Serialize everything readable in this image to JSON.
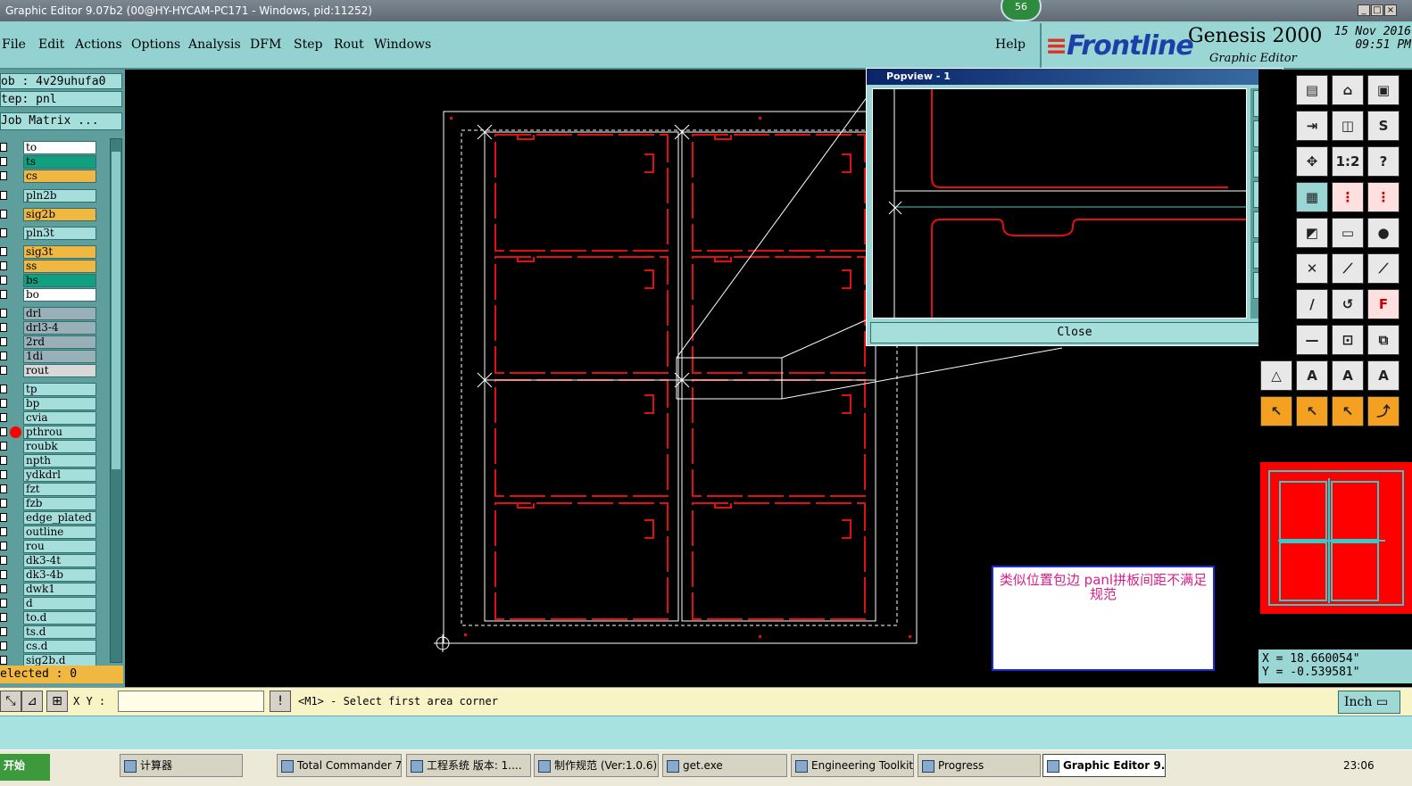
{
  "window": {
    "title": "Graphic Editor 9.07b2 (00@HY-HYCAM-PC171 - Windows, pid:11252)",
    "badge": "56"
  },
  "menu": [
    "File",
    "Edit",
    "Actions",
    "Options",
    "Analysis",
    "DFM",
    "Step",
    "Rout",
    "Windows"
  ],
  "help": "Help",
  "brand": {
    "logo": "Frontline",
    "product": "Genesis 2000",
    "subtitle": "Graphic Editor",
    "date": "15 Nov 2016",
    "time": "09:51 PM"
  },
  "job": {
    "job_line": "ob  : 4v29uhufa0",
    "step_line": "tep: pnl",
    "matrix_button": "Job Matrix ..."
  },
  "layers": [
    {
      "name": "to",
      "color": "#ffffff"
    },
    {
      "name": "ts",
      "color": "#10a080"
    },
    {
      "name": "cs",
      "color": "#f0b840"
    },
    {
      "name": "pln2b",
      "color": "#a6dedc"
    },
    {
      "name": "sig2b",
      "color": "#f0b840"
    },
    {
      "name": "pln3t",
      "color": "#a6dedc"
    },
    {
      "name": "sig3t",
      "color": "#f0b840"
    },
    {
      "name": "ss",
      "color": "#f0b840"
    },
    {
      "name": "bs",
      "color": "#10a080"
    },
    {
      "name": "bo",
      "color": "#ffffff"
    },
    {
      "name": "drl",
      "color": "#9ab0b8"
    },
    {
      "name": "drl3-4",
      "color": "#9ab0b8"
    },
    {
      "name": "2rd",
      "color": "#9ab0b8"
    },
    {
      "name": "1di",
      "color": "#9ab0b8"
    },
    {
      "name": "rout",
      "color": "#d8d8d8"
    },
    {
      "name": "tp",
      "color": "#a6dedc"
    },
    {
      "name": "bp",
      "color": "#a6dedc"
    },
    {
      "name": "cvia",
      "color": "#a6dedc"
    },
    {
      "name": "pthrou",
      "color": "#a6dedc"
    },
    {
      "name": "roubk",
      "color": "#a6dedc"
    },
    {
      "name": "npth",
      "color": "#a6dedc"
    },
    {
      "name": "ydkdrl",
      "color": "#a6dedc"
    },
    {
      "name": "fzt",
      "color": "#a6dedc"
    },
    {
      "name": "fzb",
      "color": "#a6dedc"
    },
    {
      "name": "edge_plated",
      "color": "#a6dedc"
    },
    {
      "name": "outline",
      "color": "#a6dedc"
    },
    {
      "name": "rou",
      "color": "#a6dedc"
    },
    {
      "name": "dk3-4t",
      "color": "#a6dedc"
    },
    {
      "name": "dk3-4b",
      "color": "#a6dedc"
    },
    {
      "name": "dwk1",
      "color": "#a6dedc"
    },
    {
      "name": "d",
      "color": "#a6dedc"
    },
    {
      "name": "to.d",
      "color": "#a6dedc"
    },
    {
      "name": "ts.d",
      "color": "#a6dedc"
    },
    {
      "name": "cs.d",
      "color": "#a6dedc"
    },
    {
      "name": "sig2b.d",
      "color": "#a6dedc"
    }
  ],
  "selected": "elected : 0",
  "cmd": {
    "xy_label": "X Y :",
    "xy_value": "",
    "prompt": "<M1> - Select first area corner",
    "unit": "Inch"
  },
  "popview": {
    "title": "Popview - 1",
    "close": "Close"
  },
  "coords": {
    "x": "X = 18.660054\"",
    "y": "Y = -0.539581\""
  },
  "note": "类似位置包边  panl拼板间距不满足规范",
  "taskbar": {
    "start": "开始",
    "tasks": [
      "计算器",
      "Total Commander 7.0...",
      "工程系统  版本: 1....",
      "制作规范 (Ver:1.0.6)",
      "get.exe",
      "Engineering Toolkit 9....",
      "Progress",
      "Graphic Editor 9.07..."
    ],
    "clock": "23:06"
  }
}
